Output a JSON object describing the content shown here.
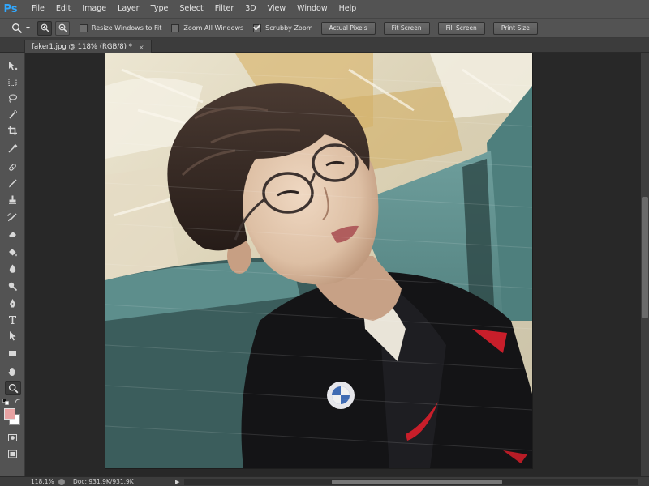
{
  "app": {
    "logo": "Ps",
    "menu": [
      "File",
      "Edit",
      "Image",
      "Layer",
      "Type",
      "Select",
      "Filter",
      "3D",
      "View",
      "Window",
      "Help"
    ]
  },
  "options": {
    "resize_windows": {
      "label": "Resize Windows to Fit",
      "checked": false
    },
    "zoom_all": {
      "label": "Zoom All Windows",
      "checked": false
    },
    "scrubby_zoom": {
      "label": "Scrubby Zoom",
      "checked": true
    },
    "buttons": [
      "Actual Pixels",
      "Fit Screen",
      "Fill Screen",
      "Print Size"
    ]
  },
  "document": {
    "tab_title": "faker1.jpg @ 118% (RGB/8) *",
    "close": "×"
  },
  "tools": [
    "move-icon",
    "marquee-icon",
    "lasso-icon",
    "quick-select-icon",
    "crop-icon",
    "eyedropper-icon",
    "healing-brush-icon",
    "brush-icon",
    "clone-stamp-icon",
    "history-brush-icon",
    "eraser-icon",
    "paint-bucket-icon",
    "blur-icon",
    "dodge-icon",
    "pen-icon",
    "type-icon",
    "path-select-icon",
    "rectangle-icon",
    "hand-icon",
    "zoom-icon"
  ],
  "colors": {
    "foreground": "#e8a2a2",
    "background": "#ffffff",
    "ps_blue": "#31a8ff"
  },
  "status": {
    "zoom": "118.1%",
    "doc": "Doc: 931.9K/931.9K",
    "arrow": "▶"
  }
}
